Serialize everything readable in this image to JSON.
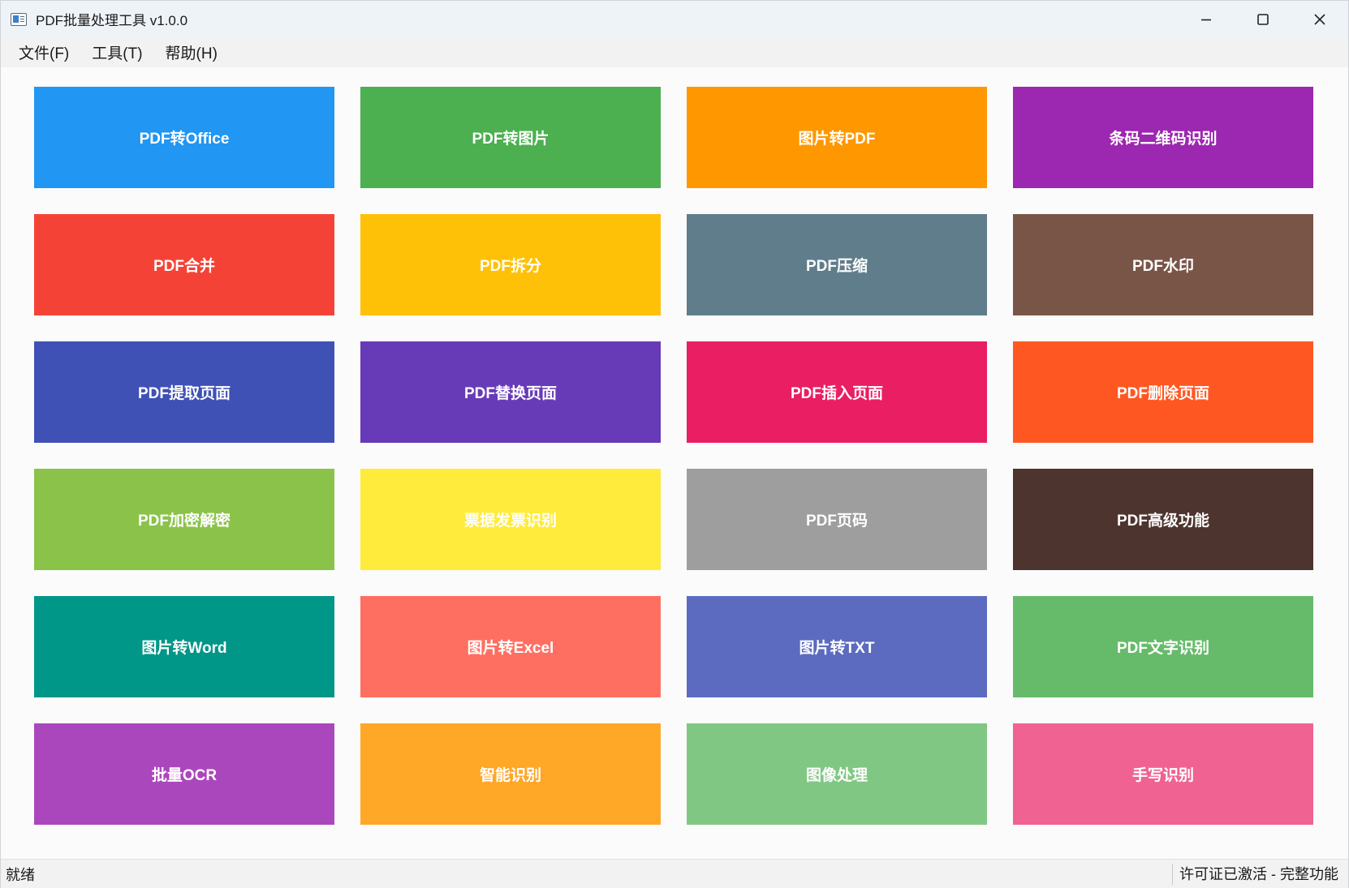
{
  "window": {
    "title": "PDF批量处理工具 v1.0.0",
    "icon": "app-window-icon"
  },
  "controls": {
    "minimize_icon": "minimize-icon",
    "maximize_icon": "maximize-icon",
    "close_icon": "close-icon"
  },
  "menu": [
    {
      "label": "文件(F)",
      "mnemonic": "F"
    },
    {
      "label": "工具(T)",
      "mnemonic": "T"
    },
    {
      "label": "帮助(H)",
      "mnemonic": "H"
    }
  ],
  "tiles": [
    {
      "label": "PDF转Office",
      "color": "#2196F3"
    },
    {
      "label": "PDF转图片",
      "color": "#4CAF50"
    },
    {
      "label": "图片转PDF",
      "color": "#FF9800"
    },
    {
      "label": "条码二维码识别",
      "color": "#9C27B0"
    },
    {
      "label": "PDF合并",
      "color": "#F44336"
    },
    {
      "label": "PDF拆分",
      "color": "#FFC107"
    },
    {
      "label": "PDF压缩",
      "color": "#607D8B"
    },
    {
      "label": "PDF水印",
      "color": "#795548"
    },
    {
      "label": "PDF提取页面",
      "color": "#3F51B5"
    },
    {
      "label": "PDF替换页面",
      "color": "#673AB7"
    },
    {
      "label": "PDF插入页面",
      "color": "#E91E63"
    },
    {
      "label": "PDF删除页面",
      "color": "#FF5722"
    },
    {
      "label": "PDF加密解密",
      "color": "#8BC34A"
    },
    {
      "label": "票据发票识别",
      "color": "#FFEB3B"
    },
    {
      "label": "PDF页码",
      "color": "#9E9E9E"
    },
    {
      "label": "PDF高级功能",
      "color": "#4E342E"
    },
    {
      "label": "图片转Word",
      "color": "#009688"
    },
    {
      "label": "图片转Excel",
      "color": "#FF6F61"
    },
    {
      "label": "图片转TXT",
      "color": "#5C6BC0"
    },
    {
      "label": "PDF文字识别",
      "color": "#66BB6A"
    },
    {
      "label": "批量OCR",
      "color": "#AB47BC"
    },
    {
      "label": "智能识别",
      "color": "#FFA726"
    },
    {
      "label": "图像处理",
      "color": "#81C784"
    },
    {
      "label": "手写识别",
      "color": "#F06292"
    }
  ],
  "status": {
    "left": "就绪",
    "right": "许可证已激活 - 完整功能"
  }
}
